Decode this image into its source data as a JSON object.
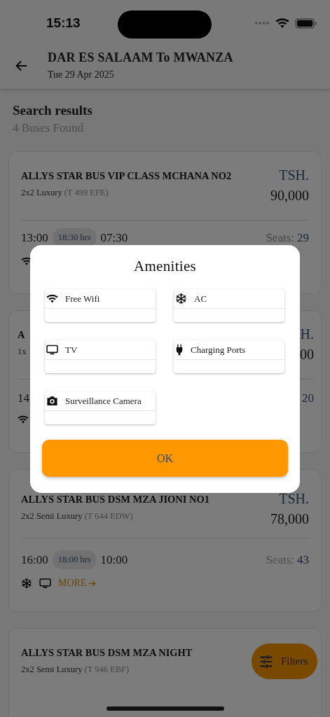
{
  "status_bar": {
    "time": "15:13"
  },
  "header": {
    "title": "DAR ES SALAAM To MWANZA",
    "date": "Tue 29 Apr 2025"
  },
  "results": {
    "title": "Search results",
    "count": "4 Buses Found"
  },
  "buses": [
    {
      "name": "ALLYS STAR BUS VIP CLASS MCHANA NO2",
      "class": "2x2 Luxury",
      "plate": "(T 499 EFE)",
      "currency": "TSH.",
      "price": "90,000",
      "departure": "13:00",
      "duration": "18:30 hrs",
      "arrival": "07:30",
      "seats_label": "Seats:",
      "seats": "29",
      "amenities": [
        {
          "kind": "wifi"
        }
      ]
    },
    {
      "name": "A",
      "class": "1x",
      "currency": "H.",
      "price": "00",
      "departure": "14",
      "seats": "20",
      "amenities": [
        {
          "kind": "wifi"
        }
      ]
    },
    {
      "name": "ALLYS STAR BUS DSM MZA JIONI NO1",
      "class": "2x2 Semi Luxury",
      "plate": "(T 644 EDW)",
      "currency": "TSH.",
      "price": "78,000",
      "departure": "16:00",
      "duration": "18:00 hrs",
      "arrival": "10:00",
      "seats_label": "Seats:",
      "seats": "43",
      "amenities": [
        {
          "kind": "snowflake"
        },
        {
          "kind": "tv"
        }
      ],
      "more": "MORE"
    },
    {
      "name": "ALLYS STAR BUS DSM MZA NIGHT",
      "class": "2x2 Semi Luxury",
      "plate": "(T 946 EBF)"
    }
  ],
  "filters_button": {
    "label": "Filters"
  },
  "dialog": {
    "title": "Amenities",
    "amenities": [
      {
        "kind": "wifi",
        "label": "Free Wifi"
      },
      {
        "kind": "snowflake",
        "label": "AC"
      },
      {
        "kind": "tv",
        "label": "TV"
      },
      {
        "kind": "plug",
        "label": "Charging Ports"
      },
      {
        "kind": "camera",
        "label": "Surveillance Camera"
      }
    ],
    "button": "OK"
  }
}
